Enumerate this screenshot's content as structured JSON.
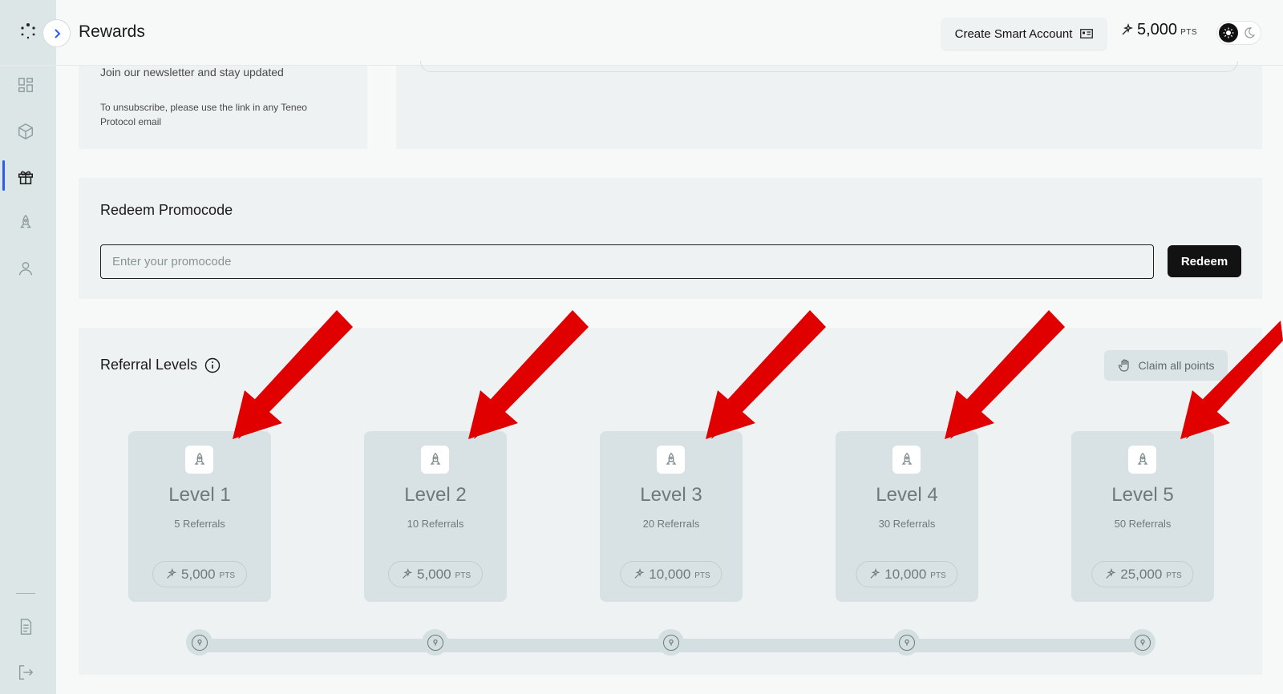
{
  "header": {
    "title": "Rewards",
    "create_account_label": "Create Smart Account",
    "points_value": "5,000",
    "points_unit": "PTS"
  },
  "sidebar": {
    "items": [
      {
        "icon": "dashboard-icon"
      },
      {
        "icon": "cube-icon"
      },
      {
        "icon": "gift-icon",
        "active": true
      },
      {
        "icon": "rocket-icon"
      },
      {
        "icon": "user-icon"
      }
    ],
    "bottom_items": [
      {
        "icon": "document-icon"
      },
      {
        "icon": "logout-icon"
      }
    ]
  },
  "newsletter": {
    "title": "Join our newsletter and stay updated",
    "note": "To unsubscribe, please use the link in any Teneo Protocol email"
  },
  "promo": {
    "title": "Redeem Promocode",
    "placeholder": "Enter your promocode",
    "button_label": "Redeem"
  },
  "referral": {
    "title": "Referral Levels",
    "claim_label": "Claim all points",
    "levels": [
      {
        "name": "Level 1",
        "referrals": "5 Referrals",
        "points": "5,000",
        "unit": "PTS"
      },
      {
        "name": "Level 2",
        "referrals": "10 Referrals",
        "points": "5,000",
        "unit": "PTS"
      },
      {
        "name": "Level 3",
        "referrals": "20 Referrals",
        "points": "10,000",
        "unit": "PTS"
      },
      {
        "name": "Level 4",
        "referrals": "30 Referrals",
        "points": "10,000",
        "unit": "PTS"
      },
      {
        "name": "Level 5",
        "referrals": "50 Referrals",
        "points": "25,000",
        "unit": "PTS"
      }
    ]
  },
  "colors": {
    "accent": "#2c5cf6",
    "annotation_arrow": "#e00000",
    "button_dark": "#121212"
  }
}
